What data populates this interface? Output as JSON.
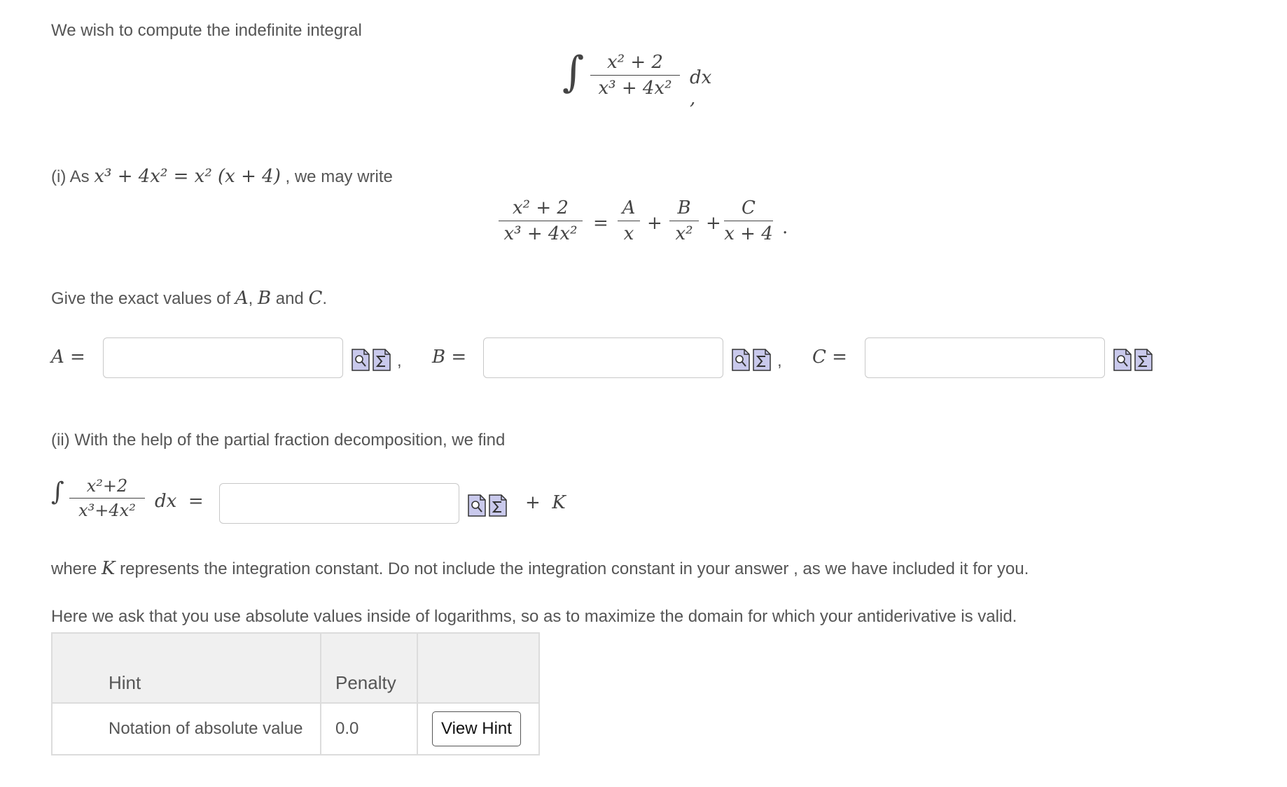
{
  "intro": {
    "text": "We wish to compute the indefinite integral",
    "integrand_num": "x² + 2",
    "integrand_den": "x³ + 4x²",
    "dx": "dx ,"
  },
  "part_i": {
    "prefix": "(i) As",
    "factor_eq": "x³ + 4x² = x² (x + 4)",
    "suffix": ", we may write",
    "lhs_num": "x² + 2",
    "lhs_den": "x³ + 4x²",
    "eq": "=",
    "a_num": "A",
    "a_den": "x",
    "b_num": "B",
    "b_den": "x²",
    "c_num": "C",
    "c_den": "x + 4",
    "plus": "+",
    "period": ".",
    "give_text": "Give the exact values of",
    "give_A": "A",
    "give_comma": ",",
    "give_B": "B",
    "give_and": "and",
    "give_C": "C",
    "give_end": "."
  },
  "answers": {
    "A_label": "A =",
    "A_value": "",
    "B_label": "B =",
    "B_value": "",
    "C_label": "C =",
    "C_value": "",
    "sep": ","
  },
  "part_ii": {
    "text": "(ii) With the help of the partial fraction decomposition, we find",
    "int_num": "x²+2",
    "int_den": "x³+4x²",
    "dx_eq": "dx  =",
    "answer_value": "",
    "plus_k": "+  K"
  },
  "notes": {
    "where_prefix": "where",
    "where_K": "K",
    "where_rest": "represents the integration constant. Do not include the integration constant in your answer , as we have included it for you.",
    "abs_note": "Here we ask that you use absolute values inside of logarithms, so as to maximize the domain for which your antiderivative is valid."
  },
  "hint_table": {
    "col_hint": "Hint",
    "col_penalty": "Penalty",
    "rows": [
      {
        "hint": "Notation of absolute value",
        "penalty": "0.0",
        "button": "View Hint"
      }
    ]
  },
  "icons": {
    "preview": "preview-icon",
    "equation": "equation-editor-icon"
  },
  "colors": {
    "icon_fill": "#c9c9ec",
    "icon_stroke": "#333333",
    "border": "#c8c8c8",
    "table_head": "#f0f0f0"
  }
}
